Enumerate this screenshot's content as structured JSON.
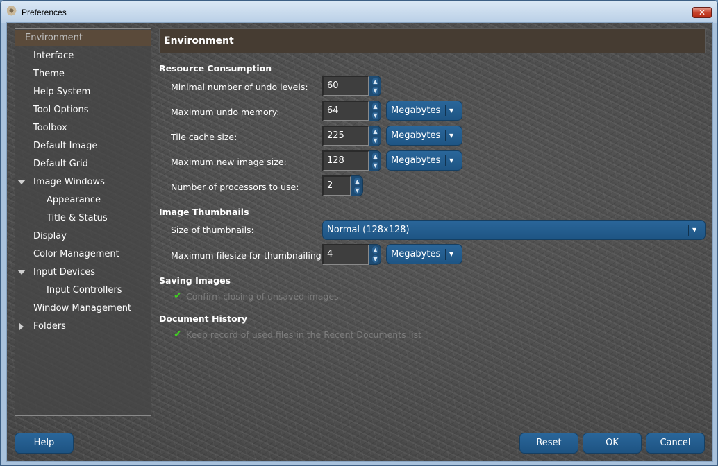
{
  "window": {
    "title": "Preferences",
    "close_glyph": "✕"
  },
  "sidebar": {
    "items": [
      {
        "label": "Environment"
      },
      {
        "label": "Interface"
      },
      {
        "label": "Theme"
      },
      {
        "label": "Help System"
      },
      {
        "label": "Tool Options"
      },
      {
        "label": "Toolbox"
      },
      {
        "label": "Default Image"
      },
      {
        "label": "Default Grid"
      },
      {
        "label": "Image Windows"
      },
      {
        "label": "Appearance"
      },
      {
        "label": "Title & Status"
      },
      {
        "label": "Display"
      },
      {
        "label": "Color Management"
      },
      {
        "label": "Input Devices"
      },
      {
        "label": "Input Controllers"
      },
      {
        "label": "Window Management"
      },
      {
        "label": "Folders"
      }
    ]
  },
  "page": {
    "title": "Environment"
  },
  "resource": {
    "title": "Resource Consumption",
    "undo_levels": {
      "label": "Minimal number of undo levels:",
      "value": "60"
    },
    "undo_memory": {
      "label": "Maximum undo memory:",
      "value": "64",
      "unit": "Megabytes"
    },
    "tile_cache": {
      "label": "Tile cache size:",
      "value": "225",
      "unit": "Megabytes"
    },
    "new_image": {
      "label": "Maximum new image size:",
      "value": "128",
      "unit": "Megabytes"
    },
    "processors": {
      "label": "Number of processors to use:",
      "value": "2"
    }
  },
  "thumbnails": {
    "title": "Image Thumbnails",
    "size": {
      "label": "Size of thumbnails:",
      "value": "Normal (128x128)"
    },
    "filesize": {
      "label": "Maximum filesize for thumbnailing:",
      "value": "4",
      "unit": "Megabytes"
    }
  },
  "saving": {
    "title": "Saving Images",
    "confirm_label": "Confirm closing of unsaved images",
    "confirm_checked": true
  },
  "history": {
    "title": "Document History",
    "keep_label": "Keep record of used files in the Recent Documents list",
    "keep_checked": true
  },
  "buttons": {
    "help": "Help",
    "reset": "Reset",
    "ok": "OK",
    "cancel": "Cancel"
  },
  "colors": {
    "accent": "#1f5587",
    "selected_row": "#5a4a3a",
    "header_bg": "#463c32",
    "check": "#40d020"
  }
}
